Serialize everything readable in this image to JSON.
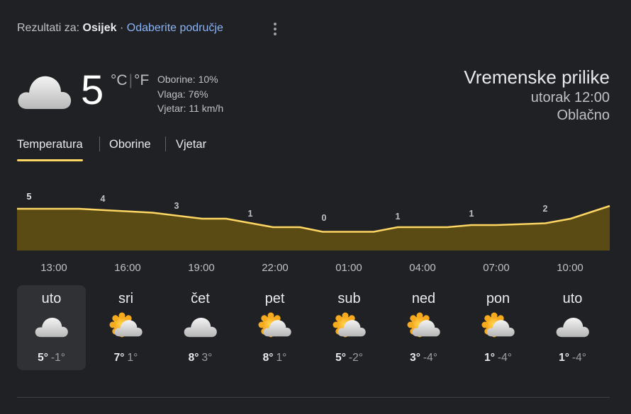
{
  "header": {
    "prefix": "Rezultati za:",
    "location": "Osijek",
    "separator": "·",
    "change_area": "Odaberite područje"
  },
  "current": {
    "icon": "cloud-icon",
    "temp": "5",
    "unit_c": "°C",
    "unit_sep": "|",
    "unit_f": "°F",
    "precipitation": "Oborine: 10%",
    "humidity": "Vlaga: 76%",
    "wind": "Vjetar: 11 km/h"
  },
  "summary": {
    "title": "Vremenske prilike",
    "datetime": "utorak 12:00",
    "condition": "Oblačno"
  },
  "tabs": [
    {
      "label": "Temperatura",
      "active": true
    },
    {
      "label": "Oborine",
      "active": false
    },
    {
      "label": "Vjetar",
      "active": false
    }
  ],
  "chart_data": {
    "type": "area",
    "x": [
      "13:00",
      "16:00",
      "19:00",
      "22:00",
      "01:00",
      "04:00",
      "07:00",
      "10:00"
    ],
    "values": [
      5,
      4,
      3,
      1,
      0,
      1,
      1,
      2
    ],
    "labels": [
      "5",
      "4",
      "3",
      "1",
      "0",
      "1",
      "1",
      "2"
    ],
    "color": "#fdd663",
    "fill": "#5a4a14"
  },
  "days": [
    {
      "name": "uto",
      "icon": "cloud-icon",
      "high": "5°",
      "low": "-1°",
      "selected": true
    },
    {
      "name": "sri",
      "icon": "partly-cloudy-icon",
      "high": "7°",
      "low": "1°",
      "selected": false
    },
    {
      "name": "čet",
      "icon": "cloud-icon",
      "high": "8°",
      "low": "3°",
      "selected": false
    },
    {
      "name": "pet",
      "icon": "partly-cloudy-icon",
      "high": "8°",
      "low": "1°",
      "selected": false
    },
    {
      "name": "sub",
      "icon": "partly-cloudy-icon",
      "high": "5°",
      "low": "-2°",
      "selected": false
    },
    {
      "name": "ned",
      "icon": "partly-cloudy-icon",
      "high": "3°",
      "low": "-4°",
      "selected": false
    },
    {
      "name": "pon",
      "icon": "partly-cloudy-icon",
      "high": "1°",
      "low": "-4°",
      "selected": false
    },
    {
      "name": "uto",
      "icon": "cloud-icon",
      "high": "1°",
      "low": "-4°",
      "selected": false
    }
  ]
}
